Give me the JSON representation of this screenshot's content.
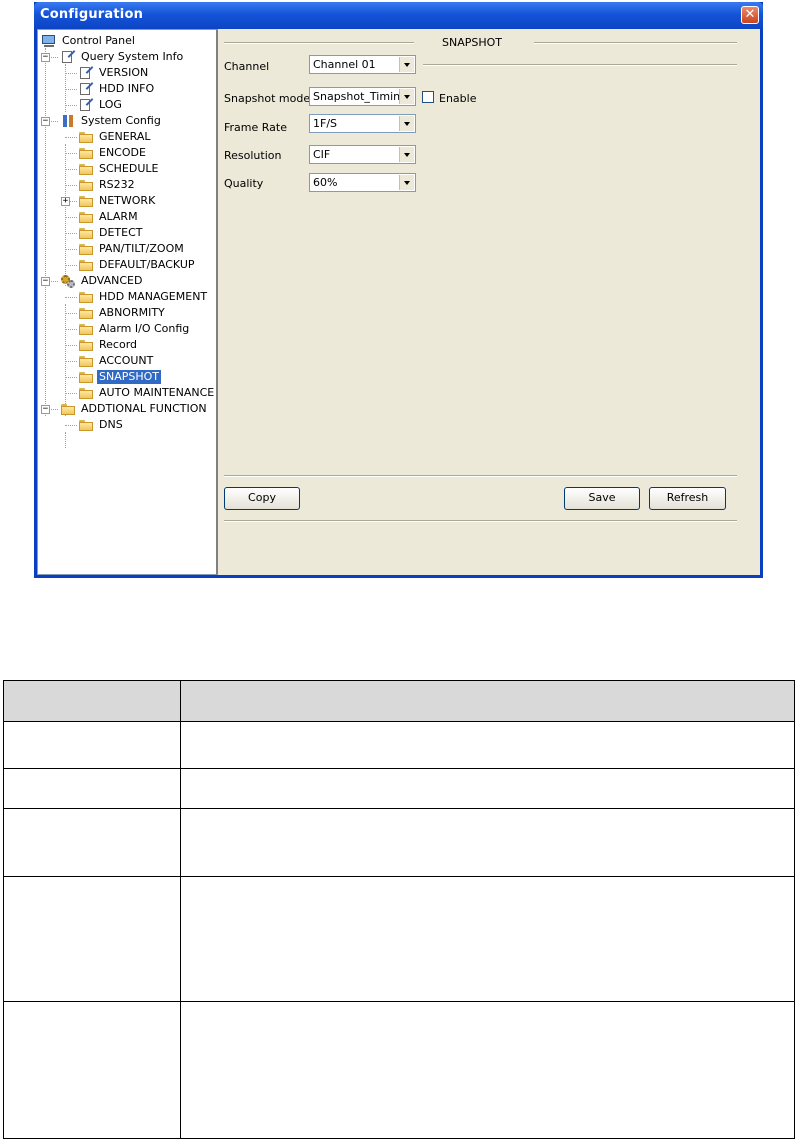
{
  "window": {
    "title": "Configuration",
    "close_symbol": "✕"
  },
  "tree": {
    "items": [
      {
        "label": "Control Panel",
        "icon": "computer-icon",
        "level": 0
      },
      {
        "label": "Query System Info",
        "icon": "doc-icon",
        "level": 1,
        "expander": "−"
      },
      {
        "label": "VERSION",
        "icon": "doc-icon",
        "level": 2
      },
      {
        "label": "HDD INFO",
        "icon": "doc-icon",
        "level": 2
      },
      {
        "label": "LOG",
        "icon": "doc-icon",
        "level": 2
      },
      {
        "label": "System Config",
        "icon": "tools-icon",
        "level": 1,
        "expander": "−"
      },
      {
        "label": "GENERAL",
        "icon": "folder-icon",
        "level": 2
      },
      {
        "label": "ENCODE",
        "icon": "folder-icon",
        "level": 2
      },
      {
        "label": "SCHEDULE",
        "icon": "folder-icon",
        "level": 2
      },
      {
        "label": "RS232",
        "icon": "folder-icon",
        "level": 2
      },
      {
        "label": "NETWORK",
        "icon": "folder-icon",
        "level": 2,
        "expander": "+"
      },
      {
        "label": "ALARM",
        "icon": "folder-icon",
        "level": 2
      },
      {
        "label": "DETECT",
        "icon": "folder-icon",
        "level": 2
      },
      {
        "label": "PAN/TILT/ZOOM",
        "icon": "folder-icon",
        "level": 2
      },
      {
        "label": "DEFAULT/BACKUP",
        "icon": "folder-icon",
        "level": 2
      },
      {
        "label": "ADVANCED",
        "icon": "gears-icon",
        "level": 1,
        "expander": "−"
      },
      {
        "label": "HDD MANAGEMENT",
        "icon": "folder-icon",
        "level": 2
      },
      {
        "label": "ABNORMITY",
        "icon": "folder-icon",
        "level": 2
      },
      {
        "label": "Alarm I/O Config",
        "icon": "folder-icon",
        "level": 2
      },
      {
        "label": "Record",
        "icon": "folder-icon",
        "level": 2
      },
      {
        "label": "ACCOUNT",
        "icon": "folder-icon",
        "level": 2
      },
      {
        "label": "SNAPSHOT",
        "icon": "folder-icon",
        "level": 2,
        "selected": true
      },
      {
        "label": "AUTO MAINTENANCE",
        "icon": "folder-icon",
        "level": 2
      },
      {
        "label": "ADDTIONAL FUNCTION",
        "icon": "folder-icon",
        "level": 1,
        "expander": "−"
      },
      {
        "label": "DNS",
        "icon": "folder-icon",
        "level": 2
      }
    ]
  },
  "panel": {
    "group_title": "SNAPSHOT",
    "channel": {
      "label": "Channel",
      "value": "Channel 01"
    },
    "snapshot_mode": {
      "label": "Snapshot mode",
      "value": "Snapshot_Timing",
      "enable_label": "Enable",
      "enabled": false
    },
    "frame_rate": {
      "label": "Frame Rate",
      "value": "1F/S"
    },
    "resolution": {
      "label": "Resolution",
      "value": "CIF"
    },
    "quality": {
      "label": "Quality",
      "value": "60%"
    },
    "buttons": {
      "copy": "Copy",
      "save": "Save",
      "refresh": "Refresh"
    }
  },
  "table": {
    "header": [
      "",
      ""
    ],
    "rows": [
      [
        "",
        ""
      ],
      [
        "",
        ""
      ],
      [
        "",
        ""
      ],
      [
        "",
        ""
      ],
      [
        "",
        ""
      ]
    ]
  },
  "colors": {
    "titlebar": "#1454d8",
    "selection": "#316ac5",
    "dialog_bg": "#ece9d8",
    "table_header_bg": "#d9d9d9"
  }
}
